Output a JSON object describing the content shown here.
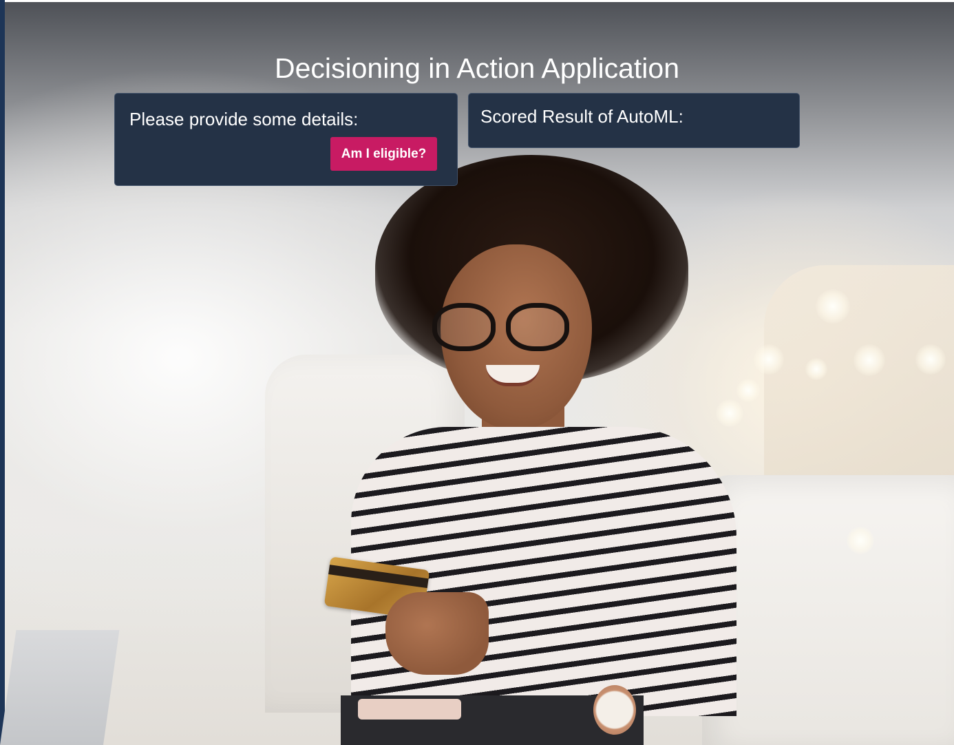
{
  "header": {
    "title": "Decisioning in Action Application"
  },
  "details_panel": {
    "heading": "Please provide some details:",
    "eligible_button_label": "Am I eligible?"
  },
  "result_panel": {
    "heading": "Scored Result of AutoML:"
  },
  "colors": {
    "panel_background": "#243246",
    "button_accent": "#c81b63",
    "title_text": "#ffffff"
  },
  "background_image": {
    "subject": "woman-holding-credit-card-photo"
  }
}
